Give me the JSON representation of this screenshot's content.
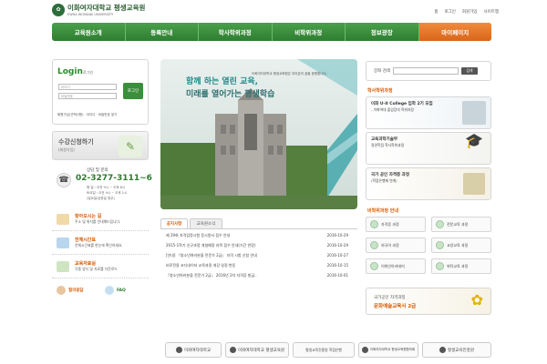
{
  "header": {
    "logo_main": "이화여자대학교 평생교육원",
    "logo_sub": "EWHA WOMANS UNIVERSITY",
    "util_links": [
      "홈",
      "로그인",
      "회원가입",
      "사이트맵"
    ]
  },
  "gnb": [
    "교육원소개",
    "등록안내",
    "학사학위과정",
    "비학위과정",
    "정보광장",
    "마이페이지"
  ],
  "login": {
    "title": "Login",
    "subtitle": "로그인",
    "id_placeholder": "아이디",
    "pw_placeholder": "비밀번호",
    "button": "로그인",
    "links": "회원가입(선택사항) · 아이디 · 비밀번호 찾기"
  },
  "apply": {
    "title": "수강신청하기",
    "sub": "(회원가입)"
  },
  "contact": {
    "title": "상담 및 문의",
    "phone": "02-3277-3111~6",
    "hours": [
      "평 일 : 오전 9시 ~ 오후 6시",
      "토요일 : 오전 9시 ~ 오후 1시",
      "(일요일/공휴일 휴무)"
    ]
  },
  "quick_links": [
    {
      "title": "찾아오시는 길",
      "desc": "주소 및 위치를 안내해드립니다."
    },
    {
      "title": "전체시간표",
      "desc": "전체시간표를 한눈에 확인하세요."
    },
    {
      "title": "교육자료실",
      "desc": "각종 양식 및 자료를 다운로드"
    }
  ],
  "mini_links": [
    "질의응답",
    "FAQ"
  ],
  "hero": {
    "headline1": "함께 하는 열린 교육,",
    "headline2": "미래를 열어가는 평생학습",
    "caption": "이화여자대학교 평생교육원은 여러분의 꿈을 응원합니다."
  },
  "notice": {
    "tabs": [
      "공지사항",
      "교육원소식"
    ],
    "rows": [
      {
        "title": "제 29회 자격검정시험 응시원서 접수 안내",
        "date": "2016-10-29"
      },
      {
        "title": "2015-1학기 신규과정 개설예정 과목 접수 안내(기간 연장)",
        "date": "2016-10-29"
      },
      {
        "title": "[안내] 『청소년여러분을 전문가 2급』 자격 시험 신청 안내",
        "date": "2016-10-27"
      },
      {
        "title": "비로전용 코디네이터 교육과정 개강 일정 변동",
        "date": "2016-10-15"
      },
      {
        "title": "『청소년여러분을 전문가 2급』 2016년 2차 자격증 발급..",
        "date": "2016-10-01"
      }
    ]
  },
  "search": {
    "label": "강좌 검색",
    "button": "검색"
  },
  "degree": {
    "title": "학사학위과정",
    "promos": [
      {
        "title": "이화 U-II College 입학 2기 모집",
        "desc": "- 이화여대 졸업장의 학위과정"
      },
      {
        "title": "교육과학기술부",
        "desc": "정관학점 학사학위과정"
      },
      {
        "title": "국가 공인 자격증 과정",
        "desc": "(학점은행제 연계)"
      }
    ]
  },
  "nondegree": {
    "title": "비학위과정 안내",
    "courses": [
      "자격증 과정",
      "전문교육 과정",
      "외국어 과정",
      "교양교육 과정",
      "이화인아카데미",
      "위탁교육 과정"
    ]
  },
  "bottom_promo": {
    "title": "국가공인 자격과정",
    "sub": "문화예술교육사 2급"
  },
  "footer": [
    "이화여자대학교",
    "이화여자대학교 평생교육원",
    "평생교육진흥원 학점은행",
    "이화여자대학교 평생교육원협의회",
    "평생교육진흥원"
  ],
  "colors": {
    "green": "#3a8f3a",
    "orange": "#e0701f"
  }
}
